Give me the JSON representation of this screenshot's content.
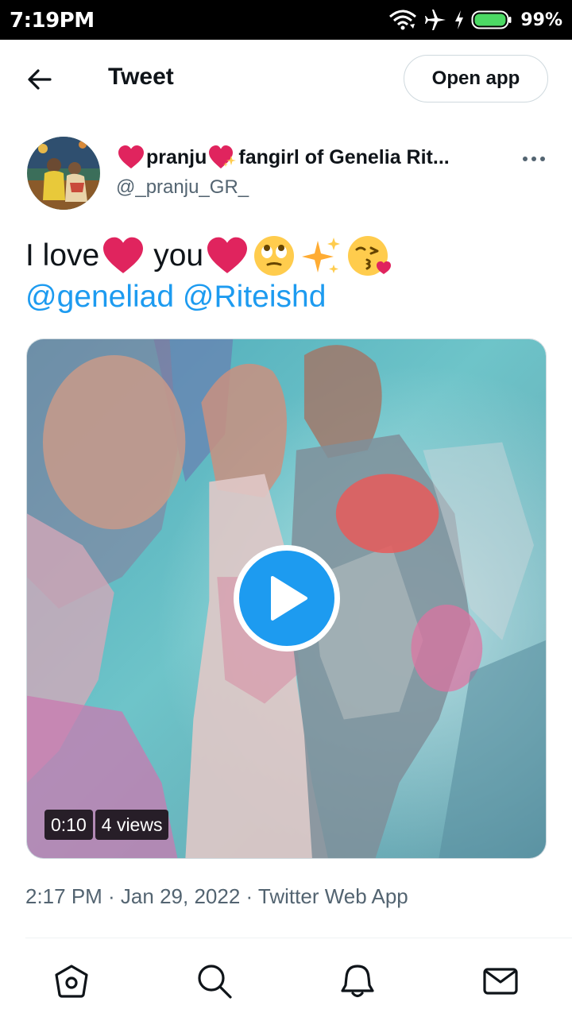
{
  "status_bar": {
    "time": "7:19PM",
    "battery_percent": "99%",
    "icons": [
      "wifi-icon",
      "airplane-mode-icon",
      "charging-icon",
      "battery-icon"
    ]
  },
  "header": {
    "title": "Tweet",
    "open_app_label": "Open app",
    "back_icon": "arrow-left-icon"
  },
  "tweet": {
    "author": {
      "name_part1": "pranju",
      "name_part2": "fangirl of Genelia Rit...",
      "handle": "@_pranju_GR_",
      "name_emojis": [
        "red-heart",
        "sparkling-heart"
      ]
    },
    "text_word1": "I love",
    "text_word2": "you",
    "text_emojis": [
      "red-heart",
      "red-heart",
      "face-with-rolling-eyes",
      "sparkles",
      "face-blowing-kiss"
    ],
    "mention1": "@geneliad",
    "mention2": "@Riteishd",
    "video": {
      "duration": "0:10",
      "views": "4 views"
    },
    "timestamp": "2:17 PM · Jan 29, 2022 · ",
    "source": "Twitter Web App"
  },
  "bottom_nav": {
    "items": [
      "home-icon",
      "search-icon",
      "notifications-icon",
      "messages-icon"
    ]
  },
  "colors": {
    "accent": "#1d9bf0",
    "secondary_text": "#536471",
    "primary_text": "#0f1419",
    "heart": "#e0245e"
  }
}
